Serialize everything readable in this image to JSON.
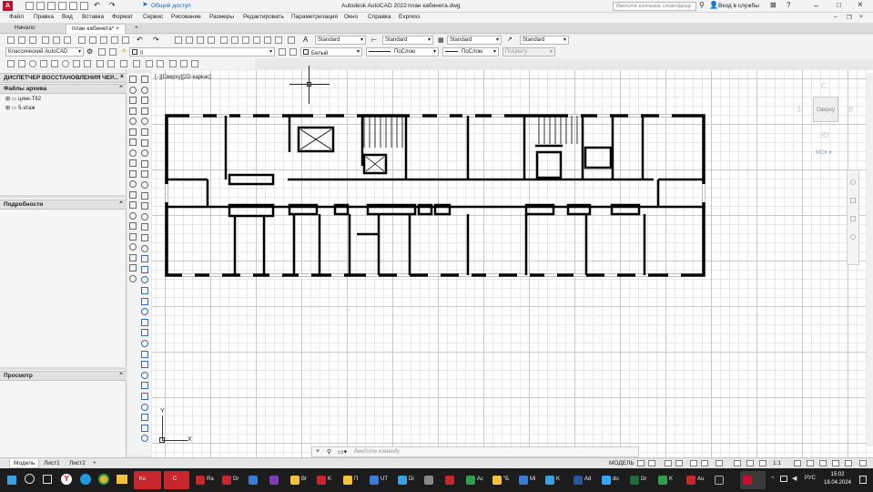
{
  "window": {
    "title": "Autodesk AutoCAD 2022",
    "filename": "план кабинета.dwg",
    "share_label": "Общий доступ",
    "search_placeholder": "Введите ключевое слово/фразу",
    "signin_label": "Вход в службы"
  },
  "menu": [
    "Файл",
    "Правка",
    "Вид",
    "Вставка",
    "Формат",
    "Сервис",
    "Рисование",
    "Размеры",
    "Редактировать",
    "Параметризация",
    "Окно",
    "Справка",
    "Express"
  ],
  "file_tabs": [
    {
      "label": "Начало",
      "active": false
    },
    {
      "label": "план кабинета*",
      "active": true
    }
  ],
  "toolbar": {
    "text_style": "Standard",
    "dim_style": "Standard",
    "table_style": "Standard",
    "mleader_style": "Standard",
    "workspace": "Классический AutoCAD",
    "layer": "0",
    "color": "Белый",
    "linetype": "ПоСлою",
    "lineweight": "ПоСлою",
    "plotstyle": "ПоЦвету"
  },
  "left_panel": {
    "title": "ДИСПЕТЧЕР ВОССТАНОВЛЕНИЯ ЧЕР...",
    "files_header": "Файлы архива",
    "files": [
      "цинк-T62",
      "5-этаж"
    ],
    "details_header": "Подробности",
    "preview_header": "Просмотр"
  },
  "viewport_label": "[−][Сверху][2D-каркас]",
  "viewcube": {
    "north": "С",
    "south": "Ю",
    "west": "З",
    "east": "В",
    "face": "Сверху",
    "wcs": "МСК"
  },
  "ucs": {
    "x": "X",
    "y": "Y"
  },
  "command_placeholder": "Введите команду",
  "layout_tabs": [
    {
      "label": "Модель",
      "active": true
    },
    {
      "label": "Лист1",
      "active": false
    },
    {
      "label": "Лист2",
      "active": false
    }
  ],
  "status": {
    "mode": "МОДЕЛЬ",
    "scale": "1:1"
  },
  "taskbar": {
    "apps": [
      "Ko",
      "C",
      "Ra",
      "Dr",
      "",
      "",
      "Br",
      "K",
      "П",
      "UT",
      "Di",
      "",
      "Gr",
      "Ac",
      "\"Б",
      "Mi",
      "K",
      "Ad",
      "do",
      "Dr",
      "K",
      "Au"
    ],
    "lang": "РУС",
    "time": "15:02",
    "date": "18.04.2024"
  }
}
